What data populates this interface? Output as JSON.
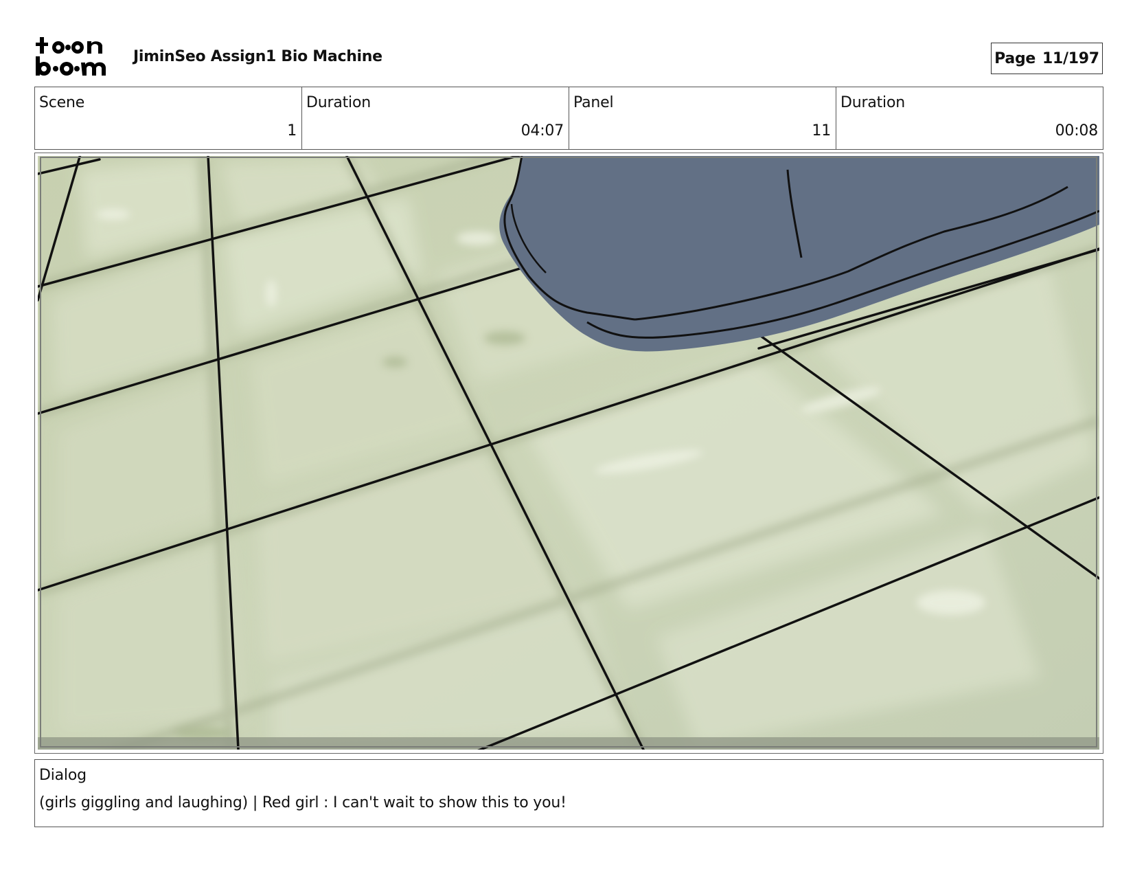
{
  "header": {
    "logo_text": "toon boom",
    "project_title": "JiminSeo Assign1 Bio Machine",
    "page_label": "Page",
    "page_value": "11/197"
  },
  "info": {
    "scene_label": "Scene",
    "scene_value": "1",
    "scene_duration_label": "Duration",
    "scene_duration_value": "04:07",
    "panel_label": "Panel",
    "panel_value": "11",
    "panel_duration_label": "Duration",
    "panel_duration_value": "00:08"
  },
  "dialog": {
    "label": "Dialog",
    "text": "(girls giggling and laughing) | Red girl : I can't wait to show this to you!"
  },
  "colors": {
    "tile_base": "#c9d2b3",
    "tile_highlight": "#dfe6cf",
    "grout_line": "#111111",
    "shoe": "#627085"
  }
}
